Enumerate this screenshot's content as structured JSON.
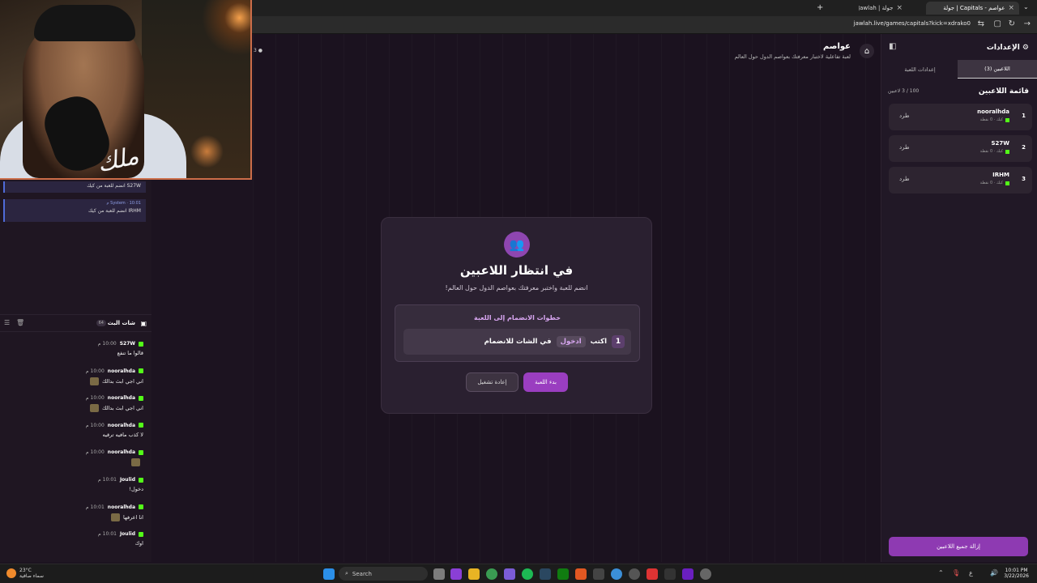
{
  "browser": {
    "tabs": [
      {
        "label": "عواصم - Capitals | جولة"
      },
      {
        "label": "جولة | Jawlah - منصة الألعاب الت"
      }
    ],
    "url": "jawlah.live/games/capitals?kick=xdrako0"
  },
  "chat": {
    "system_messages": [
      {
        "text": "S27W انضم للعبة من كيك"
      },
      {
        "user": "System",
        "time": "10:01 م",
        "text": "IRHM انضم للعبة من كيك"
      }
    ],
    "title": "شات البث",
    "count": "64",
    "messages": [
      {
        "user": "S27W",
        "time": "10:00 م",
        "text": "قالوا ما تنفع"
      },
      {
        "user": "nooralhda",
        "time": "10:00 م",
        "text": "اني اجي ابث بدالك"
      },
      {
        "user": "nooralhda",
        "time": "10:00 م",
        "text": "اني اجي ابث بدالك"
      },
      {
        "user": "nooralhda",
        "time": "10:00 م",
        "text": "لا كذب مافيه ترقيه"
      },
      {
        "user": "nooralhda",
        "time": "10:00 م",
        "text": ""
      },
      {
        "user": "Joulid",
        "time": "10:01 م",
        "text": "دخول!"
      },
      {
        "user": "nooralhda",
        "time": "10:01 م",
        "text": "انا اعرفها"
      },
      {
        "user": "Joulid",
        "time": "10:01 م",
        "text": "اوك"
      }
    ]
  },
  "game": {
    "title": "عواصم",
    "subtitle": "لعبة تفاعلية لاختبار معرفتك بعواصم الدول حول العالم",
    "modal": {
      "heading": "في انتظار اللاعبين",
      "subheading": "انضم للعبة واختبر معرفتك بعواصم الدول حول العالم!",
      "steps_title": "خطوات الانضمام إلى اللعبة",
      "step_num": "1",
      "step_pre": "اكتب",
      "step_cmd": "ادخول",
      "step_post": "في الشات للانضمام",
      "start_label": "بدء اللعبة",
      "reset_label": "إعادة تشغيل"
    }
  },
  "settings": {
    "title": "الإعدادات",
    "tab_players": "اللاعبين (3)",
    "tab_game": "إعدادات اللعبة",
    "list_title": "قائمة اللاعبين",
    "list_count": "100 / 3 لاعبين",
    "players": [
      {
        "num": "1",
        "name": "nooralhda",
        "meta": "كيك · 0 نقطة",
        "kick": "طرد"
      },
      {
        "num": "2",
        "name": "S27W",
        "meta": "كيك · 0 نقطة",
        "kick": "طرد"
      },
      {
        "num": "3",
        "name": "IRHM",
        "meta": "كيك · 0 نقطة",
        "kick": "طرد"
      }
    ],
    "remove_all": "إزالة جميع اللاعبين"
  },
  "taskbar": {
    "temp": "23°C",
    "weather": "سماء صافية",
    "search": "Search",
    "time": "10:01 PM",
    "date": "3/22/2026"
  },
  "colors": {
    "accent": "#9a3ec0",
    "kick": "#53fc18"
  }
}
